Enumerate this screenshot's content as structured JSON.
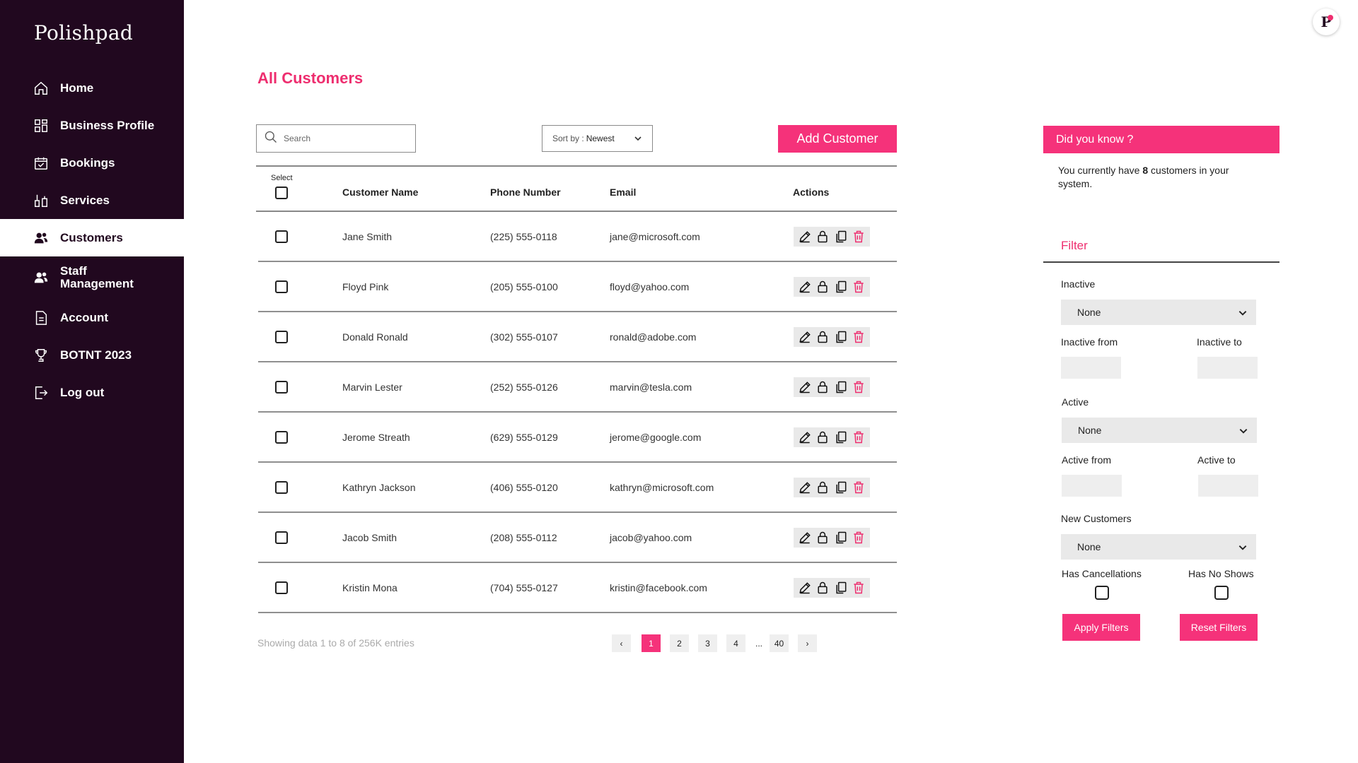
{
  "app": {
    "logo": "Polishpad",
    "avatar_letter": "P"
  },
  "sidebar": {
    "items": [
      {
        "label": "Home",
        "icon": "home-icon",
        "active": false
      },
      {
        "label": "Business Profile",
        "icon": "grid-icon",
        "active": false
      },
      {
        "label": "Bookings",
        "icon": "calendar-check-icon",
        "active": false
      },
      {
        "label": "Services",
        "icon": "services-icon",
        "active": false
      },
      {
        "label": "Customers",
        "icon": "users-icon",
        "active": true
      },
      {
        "label": "Staff Management",
        "icon": "staff-icon",
        "active": false
      },
      {
        "label": "Account",
        "icon": "document-icon",
        "active": false
      },
      {
        "label": "BOTNT 2023",
        "icon": "trophy-icon",
        "active": false
      },
      {
        "label": "Log out",
        "icon": "logout-icon",
        "active": false
      }
    ]
  },
  "main": {
    "title": "All Customers",
    "search": {
      "placeholder": "Search"
    },
    "sort": {
      "label": "Sort by : ",
      "value": "Newest"
    },
    "add_button": "Add Customer"
  },
  "table": {
    "select_label": "Select",
    "headers": {
      "name": "Customer Name",
      "phone": "Phone Number",
      "email": "Email",
      "actions": "Actions"
    },
    "rows": [
      {
        "name": "Jane Smith",
        "phone": "(225) 555-0118",
        "email": "jane@microsoft.com"
      },
      {
        "name": "Floyd Pink",
        "phone": "(205) 555-0100",
        "email": "floyd@yahoo.com"
      },
      {
        "name": "Donald Ronald",
        "phone": "(302) 555-0107",
        "email": "ronald@adobe.com"
      },
      {
        "name": "Marvin Lester",
        "phone": "(252) 555-0126",
        "email": "marvin@tesla.com"
      },
      {
        "name": "Jerome Streath",
        "phone": "(629) 555-0129",
        "email": "jerome@google.com"
      },
      {
        "name": "Kathryn Jackson",
        "phone": "(406) 555-0120",
        "email": "kathryn@microsoft.com"
      },
      {
        "name": "Jacob Smith",
        "phone": "(208) 555-0112",
        "email": "jacob@yahoo.com"
      },
      {
        "name": "Kristin Mona",
        "phone": "(704) 555-0127",
        "email": "kristin@facebook.com"
      }
    ]
  },
  "pagination": {
    "showing": "Showing data 1 to 8 of  256K entries",
    "prev": "‹",
    "next": "›",
    "pages": [
      "1",
      "2",
      "3",
      "4"
    ],
    "ellipsis": "...",
    "last": "40",
    "current": "1"
  },
  "info": {
    "title": "Did you know ?",
    "text_before": "You currently have ",
    "count": "8",
    "text_after": " customers in your system."
  },
  "filter": {
    "title": "Filter",
    "inactive_label": "Inactive",
    "inactive_value": "None",
    "inactive_from": "Inactive from",
    "inactive_to": "Inactive to",
    "active_label": "Active",
    "active_value": "None",
    "active_from": "Active from",
    "active_to": "Active to",
    "new_label": "New Customers",
    "new_value": "None",
    "has_cancellations": "Has Cancellations",
    "has_no_shows": "Has No Shows",
    "apply": "Apply Filters",
    "reset": "Reset Filters"
  },
  "colors": {
    "sidebar": "#21081f",
    "accent": "#f5327a"
  }
}
